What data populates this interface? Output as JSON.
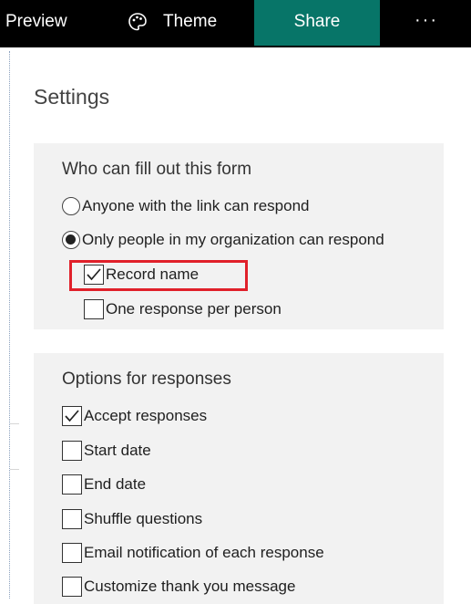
{
  "topbar": {
    "preview": "Preview",
    "theme_icon": "palette-icon",
    "theme": "Theme",
    "share": "Share",
    "more": "···",
    "share_color": "#077568"
  },
  "settings": {
    "title": "Settings",
    "who": {
      "heading": "Who can fill out this form",
      "options": [
        {
          "label": "Anyone with the link can respond",
          "selected": false
        },
        {
          "label": "Only people in my organization can respond",
          "selected": true
        }
      ],
      "suboptions": [
        {
          "label": "Record name",
          "checked": true,
          "highlighted": true
        },
        {
          "label": "One response per person",
          "checked": false
        }
      ]
    },
    "responses": {
      "heading": "Options for responses",
      "options": [
        {
          "label": "Accept responses",
          "checked": true
        },
        {
          "label": "Start date",
          "checked": false
        },
        {
          "label": "End date",
          "checked": false
        },
        {
          "label": "Shuffle questions",
          "checked": false
        },
        {
          "label": "Email notification of each response",
          "checked": false
        },
        {
          "label": "Customize thank you message",
          "checked": false
        }
      ]
    }
  },
  "highlight_color": "#e0202a"
}
